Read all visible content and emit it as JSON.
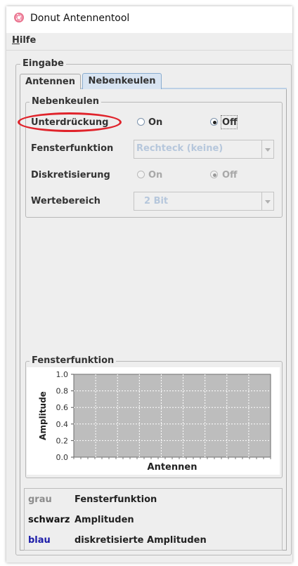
{
  "window": {
    "title": "Donut Antennentool",
    "icon": "donut-icon"
  },
  "menu": {
    "hilfe_mnemonic": "H",
    "hilfe_rest": "ilfe"
  },
  "eingabe": {
    "title": "Eingabe",
    "tabs": [
      {
        "label": "Antennen",
        "active": false
      },
      {
        "label": "Nebenkeulen",
        "active": true
      }
    ]
  },
  "nebenkeulen": {
    "title": "Nebenkeulen",
    "unterdrueckung": {
      "label": "Unterdrückung",
      "on": "On",
      "off": "Off",
      "selected": "Off"
    },
    "fensterfunktion": {
      "label": "Fensterfunktion",
      "value": "Rechteck (keine)",
      "enabled": false
    },
    "diskretisierung": {
      "label": "Diskretisierung",
      "on": "On",
      "off": "Off",
      "selected": "Off",
      "enabled": false
    },
    "wertebereich": {
      "label": "Wertebereich",
      "value": "2 Bit",
      "enabled": false
    }
  },
  "fenster_panel": {
    "title": "Fensterfunktion"
  },
  "chart_data": {
    "type": "line",
    "title": "",
    "xlabel": "Antennen",
    "ylabel": "Amplitude",
    "ylim": [
      0.0,
      1.0
    ],
    "yticks": [
      "0.0",
      "0.2",
      "0.4",
      "0.6",
      "0.8",
      "1.0"
    ],
    "grid": true,
    "series": []
  },
  "legend": [
    {
      "key": "grau",
      "text": "Fensterfunktion",
      "color": "#8c8c8c"
    },
    {
      "key": "schwarz",
      "text": "Amplituden",
      "color": "#111111"
    },
    {
      "key": "blau",
      "text": "diskretisierte Amplituden",
      "color": "#1c1ca8"
    }
  ],
  "colors": {
    "highlight": "#e0232b",
    "plot_area": "#bdbdbd",
    "active_tab": "#d8e4f2"
  }
}
